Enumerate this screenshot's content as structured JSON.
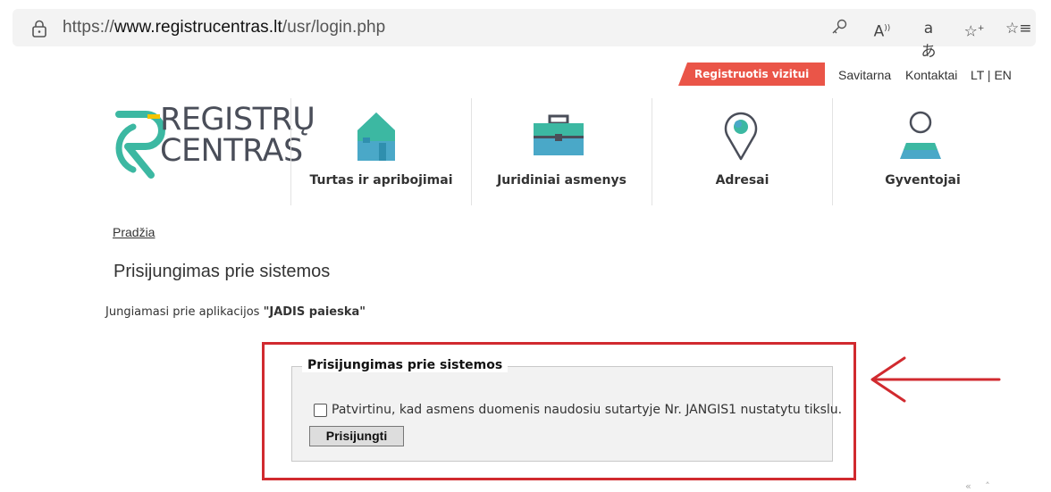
{
  "browser": {
    "url_scheme": "https://",
    "url_host": "www.registrucentras.lt",
    "url_path": "/usr/login.php",
    "icons": [
      "key-icon",
      "read-aloud-icon",
      "translate-icon",
      "favorite-add-icon",
      "favorites-icon"
    ]
  },
  "header": {
    "register_label": "Registruotis vizitui",
    "links": [
      "Savitarna",
      "Kontaktai",
      "LT | EN"
    ]
  },
  "logo": {
    "line1": "REGISTRŲ",
    "line2": "CENTRAS"
  },
  "nav": {
    "categories": [
      "Turtas ir apribojimai",
      "Juridiniai asmenys",
      "Adresai",
      "Gyventojai"
    ]
  },
  "breadcrumb": "Pradžia",
  "page": {
    "title": "Prisijungimas prie sistemos",
    "subtitle_prefix": "Jungiamasi prie aplikacijos ",
    "subtitle_app": "\"JADIS paieska\""
  },
  "login": {
    "legend": "Prisijungimas prie sistemos",
    "confirm_text": "Patvirtinu, kad asmens duomenis naudosiu sutartyje Nr. JANGIS1 nustatytu tikslu.",
    "button_label": "Prisijungti"
  },
  "footer": {
    "scroll_icons": "« ˄"
  },
  "colors": {
    "accent_red": "#ea5548",
    "highlight_red": "#d12a2f",
    "logo_green": "#3cb8a2",
    "icon_blue": "#4aa8c8"
  }
}
